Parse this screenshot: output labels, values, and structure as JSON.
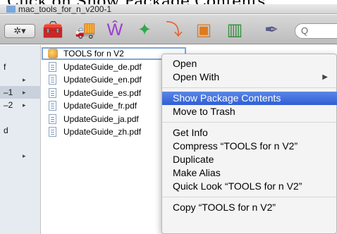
{
  "caption": "Click on Show Package Contents",
  "window": {
    "title": "mac_tools_for_n_v200-1"
  },
  "toolbar": {
    "action_label": "✲▾",
    "apps": [
      {
        "icon": "utility-app-icon",
        "glyph": "🧰",
        "color": "#6a6a6a"
      },
      {
        "icon": "truck-app-icon",
        "glyph": "🚚",
        "color": "#3b7ad9"
      },
      {
        "icon": "office-app-icon",
        "glyph": "Ŵ",
        "color": "#9c3bd1"
      },
      {
        "icon": "network-app-icon",
        "glyph": "✦",
        "color": "#2fa84f"
      },
      {
        "icon": "presentation-app-icon",
        "glyph": "⤵",
        "color": "#e8622b"
      },
      {
        "icon": "projector-app-icon",
        "glyph": "▣",
        "color": "#e07a1e"
      },
      {
        "icon": "chart-app-icon",
        "glyph": "▥",
        "color": "#2f8f3a"
      },
      {
        "icon": "pen-app-icon",
        "glyph": "✒",
        "color": "#5a5a8a"
      }
    ],
    "search_icon": "search-icon",
    "search_glyph": "Q"
  },
  "sidebar": {
    "rows": [
      {
        "label": "f",
        "arrow": "",
        "selected": false
      },
      {
        "label": "",
        "arrow": "▸",
        "selected": false
      },
      {
        "label": "–1",
        "arrow": "▸",
        "selected": true
      },
      {
        "label": "–2",
        "arrow": "▸",
        "selected": false
      },
      {
        "label": "",
        "arrow": "",
        "selected": false
      },
      {
        "label": "d",
        "arrow": "",
        "selected": false
      },
      {
        "label": "",
        "arrow": "",
        "selected": false
      },
      {
        "label": "",
        "arrow": "▸",
        "selected": false
      }
    ]
  },
  "files": [
    {
      "name": "TOOLS for n V2",
      "kind": "package",
      "highlight": true
    },
    {
      "name": "UpdateGuide_de.pdf",
      "kind": "pdf",
      "highlight": false
    },
    {
      "name": "UpdateGuide_en.pdf",
      "kind": "pdf",
      "highlight": false
    },
    {
      "name": "UpdateGuide_es.pdf",
      "kind": "pdf",
      "highlight": false
    },
    {
      "name": "UpdateGuide_fr.pdf",
      "kind": "pdf",
      "highlight": false
    },
    {
      "name": "UpdateGuide_ja.pdf",
      "kind": "pdf",
      "highlight": false
    },
    {
      "name": "UpdateGuide_zh.pdf",
      "kind": "pdf",
      "highlight": false
    }
  ],
  "context_menu": {
    "groups": [
      [
        {
          "label": "Open",
          "submenu": false,
          "active": false
        },
        {
          "label": "Open With",
          "submenu": true,
          "active": false
        }
      ],
      [
        {
          "label": "Show Package Contents",
          "submenu": false,
          "active": true
        },
        {
          "label": "Move to Trash",
          "submenu": false,
          "active": false
        }
      ],
      [
        {
          "label": "Get Info",
          "submenu": false,
          "active": false
        },
        {
          "label": "Compress “TOOLS for n V2”",
          "submenu": false,
          "active": false
        },
        {
          "label": "Duplicate",
          "submenu": false,
          "active": false
        },
        {
          "label": "Make Alias",
          "submenu": false,
          "active": false
        },
        {
          "label": "Quick Look “TOOLS for n V2”",
          "submenu": false,
          "active": false
        }
      ],
      [
        {
          "label": "Copy “TOOLS for n V2”",
          "submenu": false,
          "active": false
        }
      ]
    ],
    "submenu_glyph": "▶"
  }
}
